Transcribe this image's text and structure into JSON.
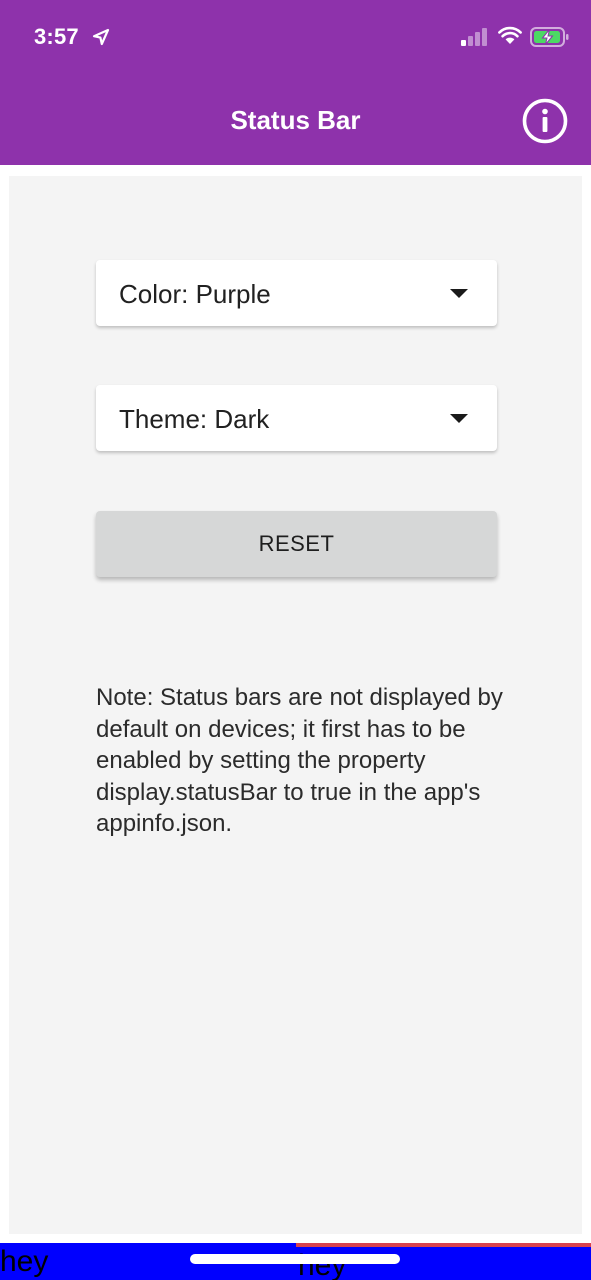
{
  "status_bar": {
    "time": "3:57",
    "icons": [
      "location-arrow-icon",
      "signal-icon",
      "wifi-icon",
      "battery-charging-icon"
    ]
  },
  "header": {
    "title": "Status Bar",
    "info_icon": "info-icon"
  },
  "controls": {
    "color_select": {
      "label": "Color: Purple"
    },
    "theme_select": {
      "label": "Theme: Dark"
    },
    "reset_label": "RESET"
  },
  "note": "Note: Status bars are not displayed by default on devices; it first has to be enabled by setting the property display.statusBar to true in the app's appinfo.json.",
  "bottom": {
    "left_text": "hey",
    "center_text": "hey"
  },
  "colors": {
    "header_bg": "#8e32ab",
    "content_bg": "#f4f4f4",
    "bottom_bg": "#0000ff",
    "bottom_accent": "#d8424e",
    "battery_green": "#4cd964"
  }
}
